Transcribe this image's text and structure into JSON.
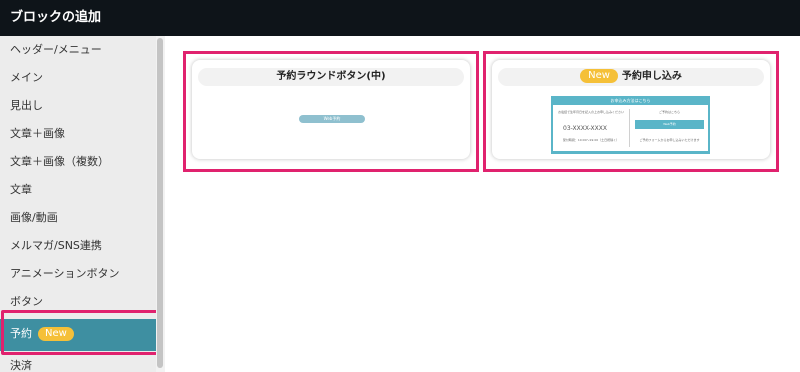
{
  "header": {
    "title": "ブロックの追加"
  },
  "sidebar": {
    "items": [
      {
        "label": "ヘッダー/メニュー"
      },
      {
        "label": "メイン"
      },
      {
        "label": "見出し"
      },
      {
        "label": "文章＋画像"
      },
      {
        "label": "文章＋画像（複数）"
      },
      {
        "label": "文章"
      },
      {
        "label": "画像/動画"
      },
      {
        "label": "メルマガ/SNS連携"
      },
      {
        "label": "アニメーションボタン"
      },
      {
        "label": "ボタン"
      },
      {
        "label": "予約",
        "badge": "New"
      },
      {
        "label": "決済"
      }
    ]
  },
  "cards": [
    {
      "title": "予約ラウンドボタン(中)",
      "preview_button": "Web予約"
    },
    {
      "title": "予約申し込み",
      "badge": "New",
      "preview": {
        "header": "お申込み方法はこちら",
        "left_caption": "お電話で生年月日を記入の上お申し込みください",
        "phone": "03-XXXX-XXXX",
        "left_note": "受付時間：10:00〜19:00（土日祝除く）",
        "right_caption": "ご予約はこちら",
        "right_button": "Web予約",
        "right_note": "ご予約フォームからお申し込みいただけます"
      }
    }
  ],
  "colors": {
    "accent": "#3e8fa1",
    "highlight": "#e0226e",
    "badge": "#f5c038",
    "header_bg": "#0e1419"
  }
}
